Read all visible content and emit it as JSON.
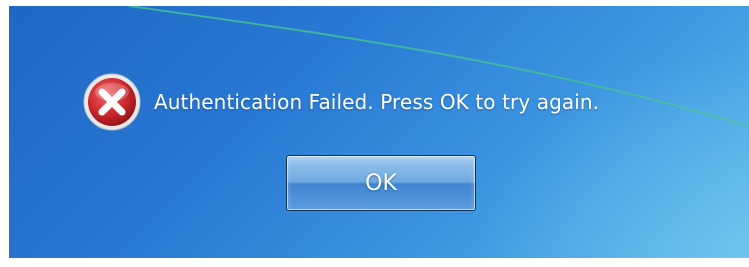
{
  "dialog": {
    "message": "Authentication Failed. Press OK to try again.",
    "icon": "error-x-icon",
    "ok_label": "OK"
  },
  "colors": {
    "background": "#2a78d4",
    "text": "#ffffff",
    "error_icon": "#c8242a",
    "swoosh": "#3fbf9a"
  }
}
